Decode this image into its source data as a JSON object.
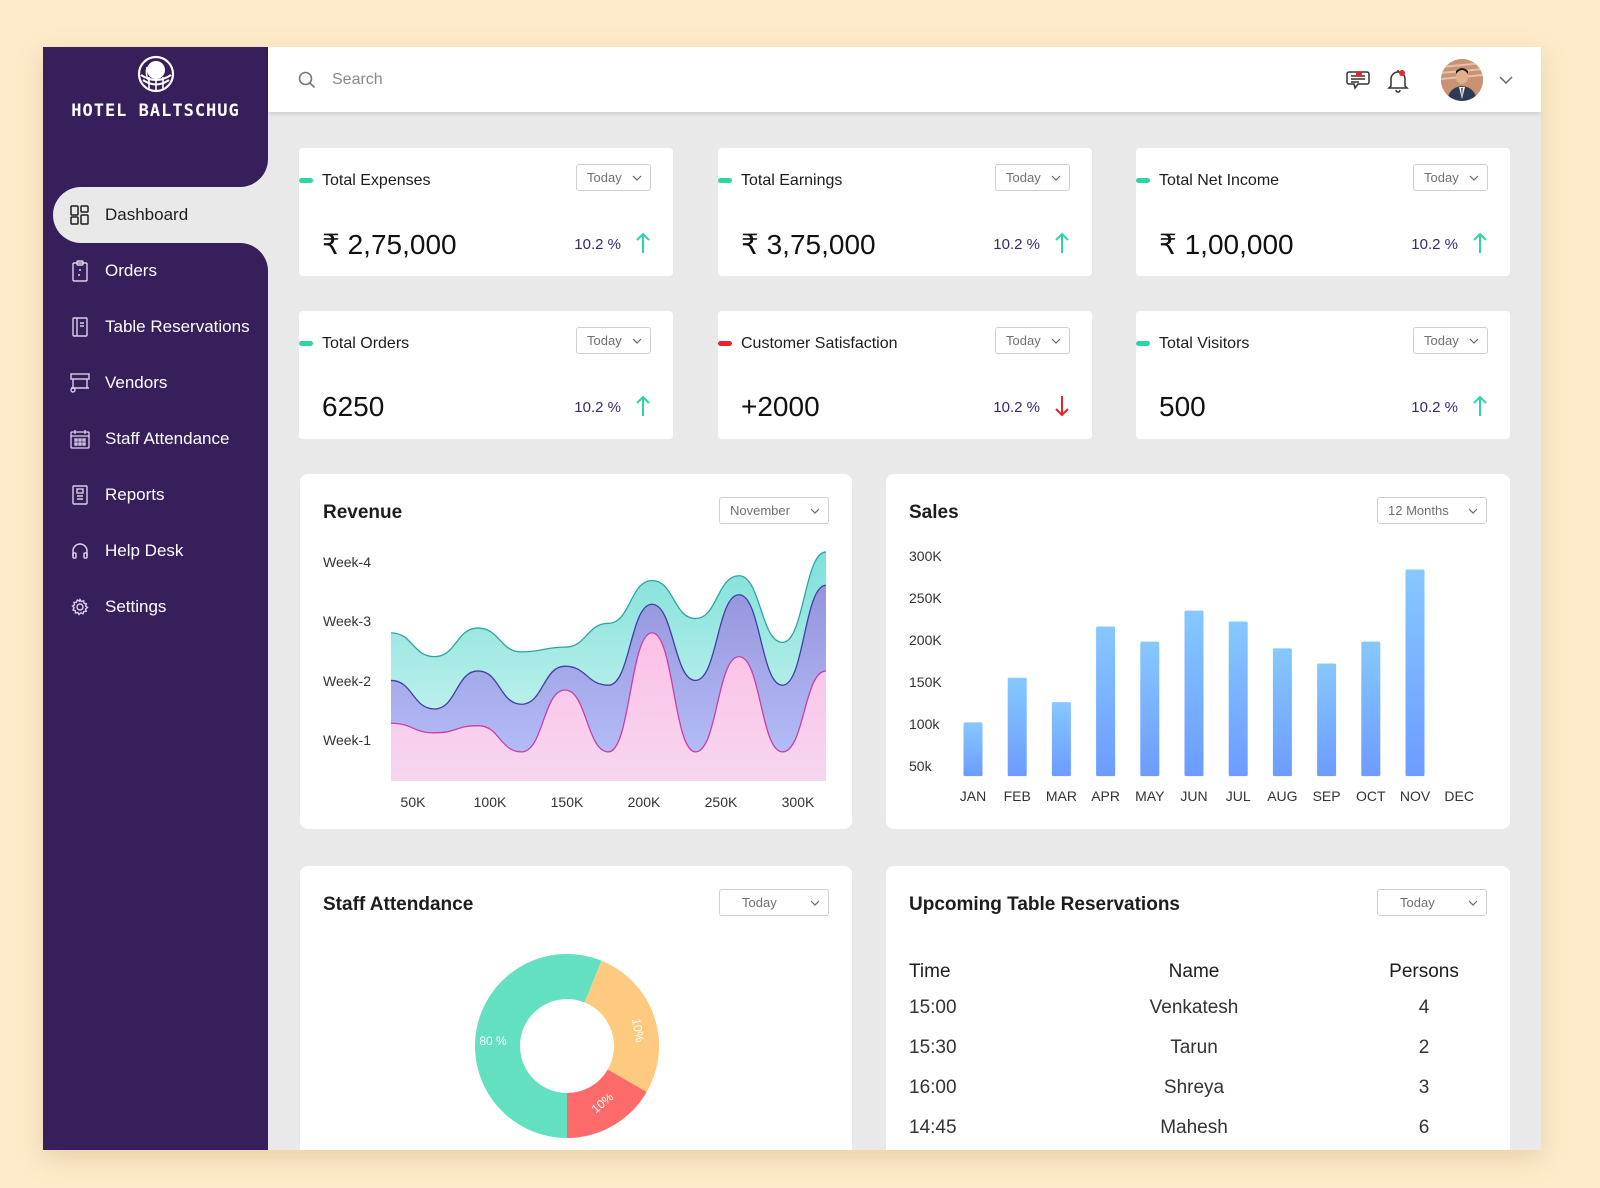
{
  "brand": {
    "name": "HOTEL BALTSCHUG",
    "logo_icon": "globe-logo-icon"
  },
  "sidebar": {
    "items": [
      {
        "label": "Dashboard",
        "icon": "dashboard-grid-icon",
        "active": true
      },
      {
        "label": "Orders",
        "icon": "clipboard-icon",
        "active": false
      },
      {
        "label": "Table Reservations",
        "icon": "notebook-icon",
        "active": false
      },
      {
        "label": "Vendors",
        "icon": "vendor-cart-icon",
        "active": false
      },
      {
        "label": "Staff Attendance",
        "icon": "calendar-icon",
        "active": false
      },
      {
        "label": "Reports",
        "icon": "report-icon",
        "active": false
      },
      {
        "label": "Help Desk",
        "icon": "headphones-icon",
        "active": false
      },
      {
        "label": "Settings",
        "icon": "gear-icon",
        "active": false
      }
    ]
  },
  "header": {
    "search": {
      "placeholder": "Search",
      "value": ""
    },
    "icons": [
      "message-icon",
      "bell-icon"
    ],
    "notification_dot_color": "#e8232a"
  },
  "colors": {
    "sidebar_bg": "#361f5a",
    "accent_green": "#2dd4a7",
    "accent_red": "#e8232a",
    "pct_text": "#3a2672"
  },
  "stats": [
    {
      "title": "Total Expenses",
      "period": "Today",
      "value": "₹ 2,75,000",
      "change": "10.2 %",
      "trend": "up",
      "marker": "#2dd4a7"
    },
    {
      "title": "Total Earnings",
      "period": "Today",
      "value": "₹ 3,75,000",
      "change": "10.2 %",
      "trend": "up",
      "marker": "#2dd4a7"
    },
    {
      "title": "Total Net Income",
      "period": "Today",
      "value": "₹ 1,00,000",
      "change": "10.2 %",
      "trend": "up",
      "marker": "#2dd4a7"
    },
    {
      "title": "Total Orders",
      "period": "Today",
      "value": "6250",
      "change": "10.2 %",
      "trend": "up",
      "marker": "#2dd4a7"
    },
    {
      "title": "Customer Satisfaction",
      "period": "Today",
      "value": "+2000",
      "change": "10.2 %",
      "trend": "down",
      "marker": "#e8232a"
    },
    {
      "title": "Total Visitors",
      "period": "Today",
      "value": "500",
      "change": "10.2 %",
      "trend": "up",
      "marker": "#2dd4a7"
    }
  ],
  "revenue": {
    "title": "Revenue",
    "period": "November"
  },
  "sales": {
    "title": "Sales",
    "period": "12 Months"
  },
  "attendance": {
    "title": "Staff Attendance",
    "period": "Today"
  },
  "reservations": {
    "title": "Upcoming Table Reservations",
    "period": "Today",
    "columns": [
      "Time",
      "Name",
      "Persons"
    ],
    "rows": [
      [
        "15:00",
        "Venkatesh",
        "4"
      ],
      [
        "15:30",
        "Tarun",
        "2"
      ],
      [
        "16:00",
        "Shreya",
        "3"
      ],
      [
        "14:45",
        "Mahesh",
        "6"
      ]
    ]
  },
  "chart_data": [
    {
      "type": "area",
      "title": "Revenue",
      "stacked": true,
      "x": [
        "50K",
        "100K",
        "150K",
        "200K",
        "250K",
        "300K"
      ],
      "xlabel": "",
      "y_categories": [
        "Week-1",
        "Week-2",
        "Week-3",
        "Week-4"
      ],
      "ylabel": "",
      "series": [
        {
          "name": "Week-1",
          "color": "#f7c6e8",
          "line": "#c93fa4",
          "values": [
            0.9,
            0.7,
            0.85,
            0.3,
            1.6,
            0.3,
            2.8,
            0.3,
            2.3,
            0.3,
            2.0
          ]
        },
        {
          "name": "Week-2",
          "color": "#a5a8ec",
          "line": "#3e3fa3",
          "values": [
            1.8,
            1.2,
            2.0,
            1.3,
            2.1,
            1.7,
            3.4,
            1.8,
            3.6,
            1.7,
            3.8
          ]
        },
        {
          "name": "Week-3",
          "color": "#a6ebe6",
          "line": "#2aa7a0",
          "values": [
            2.8,
            2.3,
            2.9,
            2.4,
            2.5,
            3.0,
            3.9,
            3.1,
            4.0,
            2.6,
            4.5
          ]
        }
      ],
      "note": "series values are approximate stacked heights in Week units at evenly spaced sample points"
    },
    {
      "type": "bar",
      "title": "Sales",
      "categories": [
        "JAN",
        "FEB",
        "MAR",
        "APR",
        "MAY",
        "JUN",
        "JUL",
        "AUG",
        "SEP",
        "OCT",
        "NOV",
        "DEC"
      ],
      "values": [
        102000,
        155000,
        126000,
        216000,
        198000,
        235000,
        222000,
        190000,
        172000,
        198000,
        284000,
        null
      ],
      "yticks": [
        "50k",
        "100k",
        "150K",
        "200K",
        "250K",
        "300K"
      ],
      "ylim": [
        38000,
        300000
      ],
      "xlabel": "",
      "ylabel": "",
      "bar_gradient": [
        "#86c8ff",
        "#6d9bff"
      ]
    },
    {
      "type": "pie",
      "title": "Staff Attendance",
      "donut": true,
      "labels": [
        "80 %",
        "10%",
        "10%"
      ],
      "values": [
        80,
        10,
        10
      ],
      "colors": [
        "#63e0c0",
        "#fdca80",
        "#fd6a6a"
      ]
    }
  ]
}
